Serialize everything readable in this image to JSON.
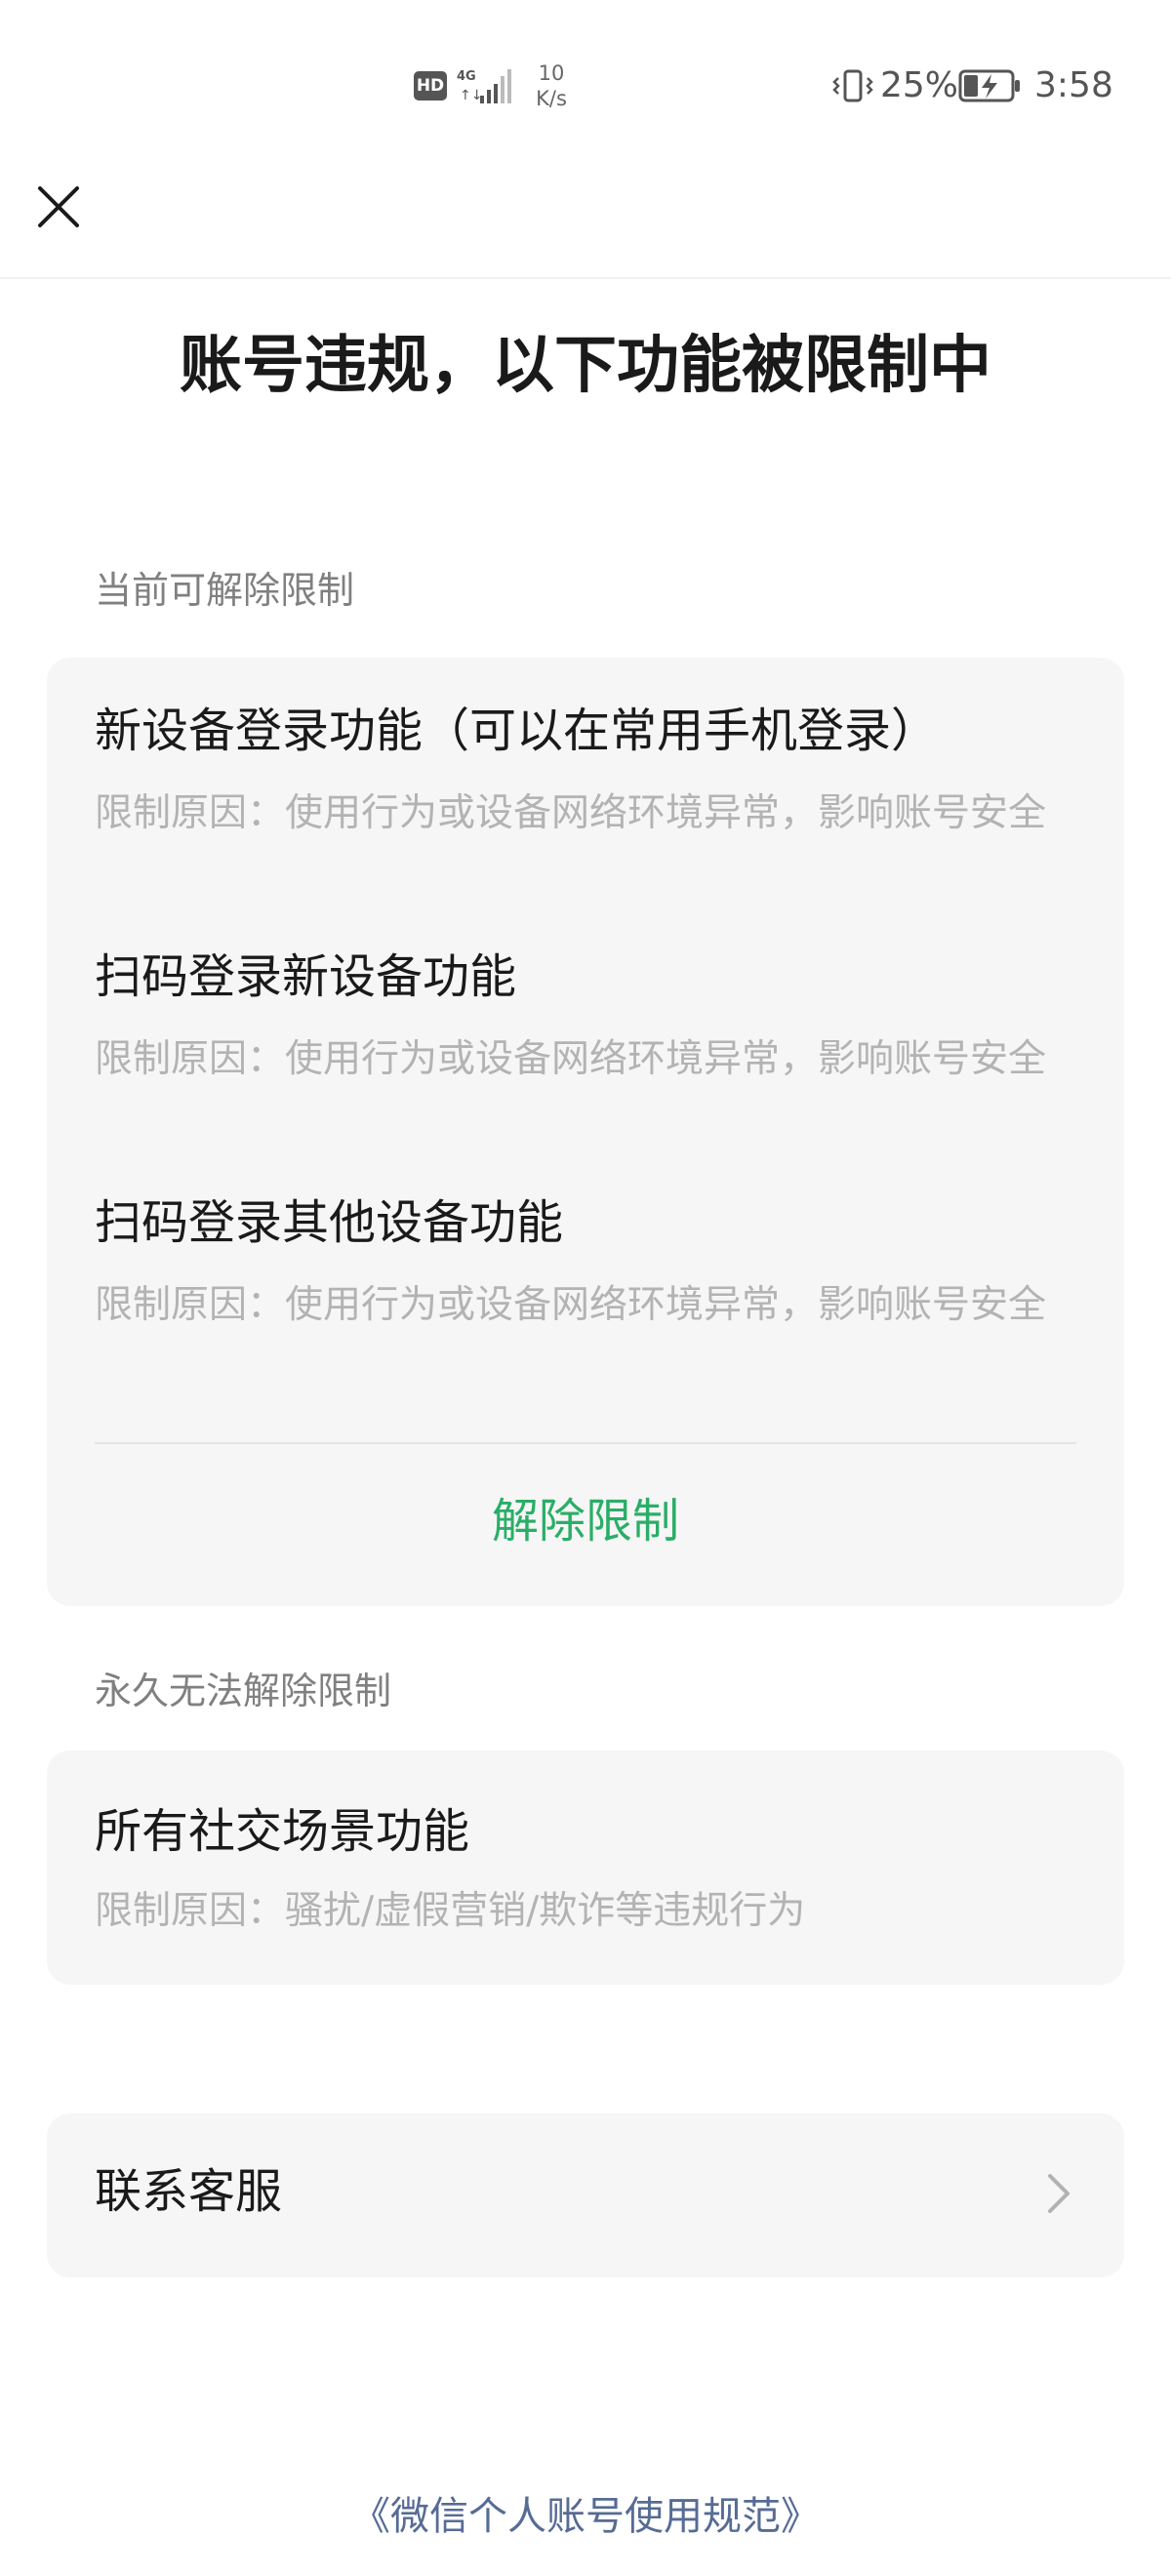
{
  "status_bar": {
    "hd_badge": "HD",
    "network_label": "4G",
    "speed_value": "10",
    "speed_unit": "K/s",
    "battery_percent": "25%",
    "time": "3:58"
  },
  "header": {
    "close_icon": "close-icon",
    "title": "账号违规，以下功能被限制中"
  },
  "current_section": {
    "label": "当前可解除限制",
    "items": [
      {
        "title": "新设备登录功能（可以在常用手机登录）",
        "reason": "限制原因：使用行为或设备网络环境异常，影响账号安全"
      },
      {
        "title": "扫码登录新设备功能",
        "reason": "限制原因：使用行为或设备网络环境异常，影响账号安全"
      },
      {
        "title": "扫码登录其他设备功能",
        "reason": "限制原因：使用行为或设备网络环境异常，影响账号安全"
      }
    ],
    "action_label": "解除限制",
    "action_color": "#2aae67"
  },
  "permanent_section": {
    "label": "永久无法解除限制",
    "items": [
      {
        "title": "所有社交场景功能",
        "reason": "限制原因：骚扰/虚假营销/欺诈等违规行为"
      }
    ]
  },
  "contact": {
    "label": "联系客服",
    "icon": "chevron-right-icon"
  },
  "footer": {
    "link_text": "《微信个人账号使用规范》",
    "link_color": "#576b95"
  }
}
